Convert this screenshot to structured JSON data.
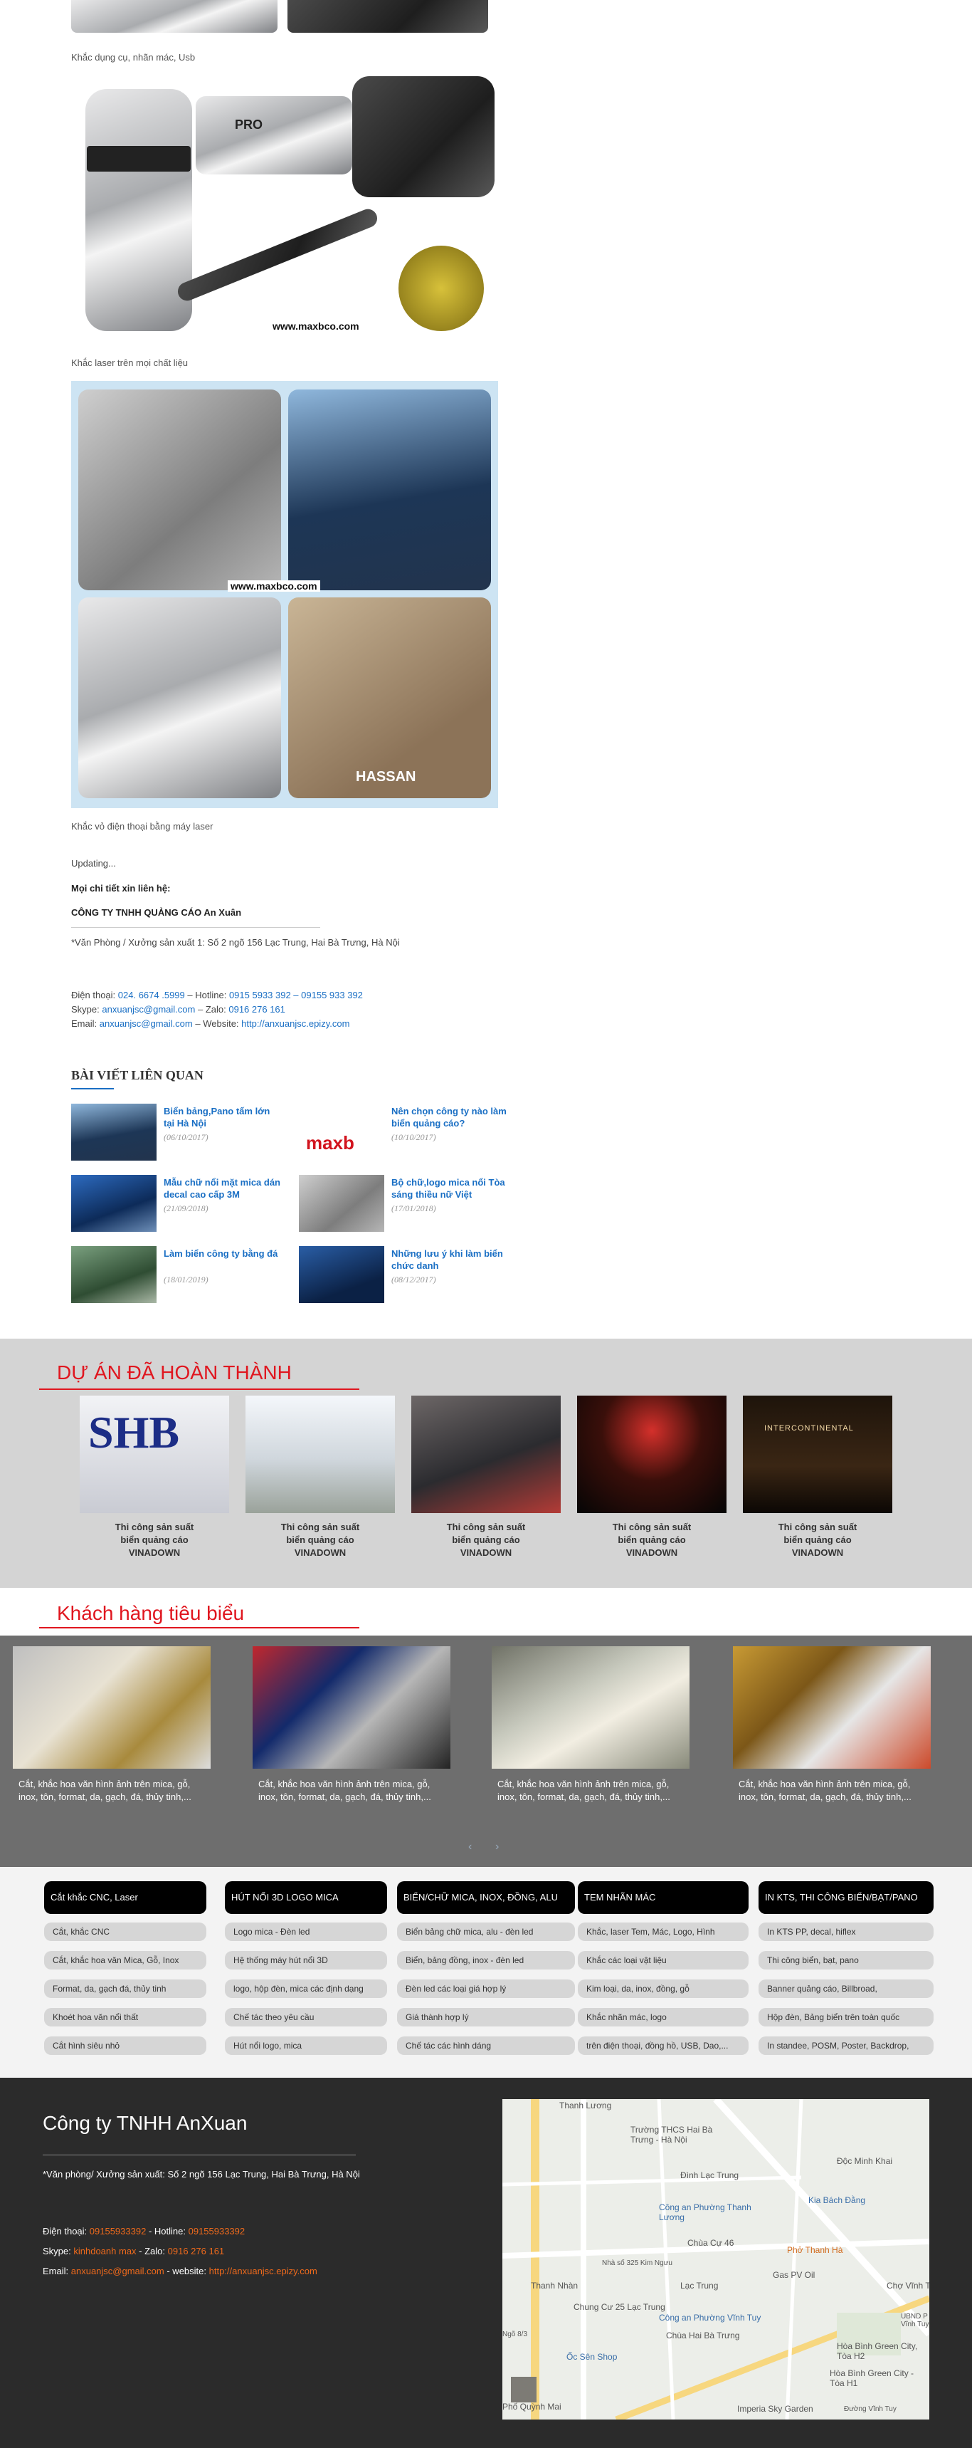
{
  "article": {
    "caption_tools": "Khắc dụng cụ, nhãn mác, Usb",
    "watermark": "www.maxbco.com",
    "caption_laser": "Khắc laser trên mọi chất liệu",
    "caption_phone": "Khắc vỏ điện thoại bằng máy laser",
    "updating": "Updating...",
    "contact_heading": "Mọi chi tiết xin liên hệ:",
    "company": "CÔNG TY TNHH QUẢNG CÁO An Xuân",
    "address": "*Văn Phòng / Xưởng sản xuất 1: Số 2 ngõ 156 Lạc Trung, Hai Bà Trưng, Hà Nội",
    "phone_label": "Điện thoại:",
    "phone": "024. 6674 .5999",
    "hotline_label": "– Hotline:",
    "hotline": "0915 5933 392 – 09155 933 392",
    "skype_label": "Skype:",
    "skype": "anxuanjsc@gmail.com",
    "zalo_label": "– Zalo:",
    "zalo": "0916 276 161",
    "email_label": "Email:",
    "email": "anxuanjsc@gmail.com",
    "website_label": "– Website:",
    "website": "http://anxuanjsc.epizy.com"
  },
  "related": {
    "heading": "BÀI VIẾT LIÊN QUAN",
    "items": [
      {
        "title": "Biển bảng,Pano tấm lớn tại Hà Nội",
        "date": "(06/10/2017)"
      },
      {
        "title": "Nên chọn công ty nào làm biển quảng cáo?",
        "date": "(10/10/2017)",
        "logo": "maxb"
      },
      {
        "title": "Mẫu chữ nổi mặt mica dán decal cao cấp 3M",
        "date": "(21/09/2018)"
      },
      {
        "title": "Bộ chữ,logo mica nổi Tòa sáng thiều nữ Việt",
        "date": "(17/01/2018)"
      },
      {
        "title": "Làm biển công ty bằng đá",
        "date": "(18/01/2019)"
      },
      {
        "title": "Những lưu ý khi làm biển chức danh",
        "date": "(08/12/2017)"
      }
    ]
  },
  "projects": {
    "heading": "DỰ ÁN ĐÃ HOÀN THÀNH",
    "items": [
      {
        "line1": "Thi công sản suất",
        "line2": "biển quảng cáo",
        "line3": "VINADOWN",
        "sign": "SHB"
      },
      {
        "line1": "Thi công sản suất",
        "line2": "biển quảng cáo",
        "line3": "VINADOWN",
        "sign": ""
      },
      {
        "line1": "Thi công sản suất",
        "line2": "biển quảng cáo",
        "line3": "VINADOWN",
        "sign": ""
      },
      {
        "line1": "Thi công sản suất",
        "line2": "biển quảng cáo",
        "line3": "VINADOWN",
        "sign": ""
      },
      {
        "line1": "Thi công sản suất",
        "line2": "biển quảng cáo",
        "line3": "VINADOWN",
        "sign": "INTERCONTINENTAL"
      }
    ]
  },
  "customers": {
    "heading": "Khách hàng tiêu biểu",
    "items": [
      {
        "line1": "Cắt, khắc hoa văn hình ảnh trên mica, gỗ,",
        "line2": "inox, tôn, format, da, gạch, đá, thủy tinh,..."
      },
      {
        "line1": "Cắt, khắc hoa văn hình ảnh trên mica, gỗ,",
        "line2": "inox, tôn, format, da, gạch, đá, thủy tinh,..."
      },
      {
        "line1": "Cắt, khắc hoa văn hình ảnh trên mica, gỗ,",
        "line2": "inox, tôn, format, da, gạch, đá, thủy tinh,..."
      },
      {
        "line1": "Cắt, khắc hoa văn hình ảnh trên mica, gỗ,",
        "line2": "inox, tôn, format, da, gạch, đá, thủy tinh,..."
      }
    ],
    "prev": "‹",
    "next": "›"
  },
  "categories": [
    {
      "title": "Cắt khắc CNC, Laser",
      "items": [
        "Cắt, khắc CNC",
        "Cắt, khắc hoa văn Mica, Gỗ, Inox",
        "Format, da, gạch đá, thủy tinh",
        "Khoét hoa văn nổi thất",
        "Cắt hình siêu nhỏ"
      ]
    },
    {
      "title": "HÚT NỔI 3D LOGO MICA",
      "items": [
        "Logo mica - Đèn led",
        "Hệ thống máy hút nổi 3D",
        "logo, hộp đèn, mica các định dạng",
        "Chế tác theo yêu cầu",
        "Hút nổi logo, mica"
      ]
    },
    {
      "title": "BIỂN/CHỮ MICA, INOX, ĐỒNG, ALU",
      "items": [
        "Biển bảng chữ mica, alu - đèn led",
        "Biển, bảng đồng, inox - đèn led",
        "Đèn led các loại giá hợp lý",
        "Giá thành hợp lý",
        "Chế tác các hình dáng"
      ]
    },
    {
      "title": "TEM NHÃN MÁC",
      "items": [
        "Khắc, laser Tem, Mác, Logo, Hình",
        "Khắc các loại vật liệu",
        "Kim loại, da, inox, đồng, gỗ",
        "Khắc nhãn mác, logo",
        "trên điện thoại, đồng hồ, USB, Dao,..."
      ]
    },
    {
      "title": "IN KTS, THI CÔNG BIỂN/BẠT/PANO",
      "items": [
        "In KTS PP, decal, hiflex",
        "Thi công biển, bạt, pano",
        "Banner quảng cáo, Billbroad,",
        "Hộp đèn, Bảng biển trên toàn quốc",
        "In standee, POSM, Poster, Backdrop,"
      ]
    }
  ],
  "footer": {
    "title": "Công ty TNHH AnXuan",
    "address": "*Văn phòng/ Xưởng sản xuất: Số 2 ngõ 156 Lạc Trung, Hai Bà Trưng, Hà Nội",
    "phone_label": "Điện thoại:",
    "phone": "09155933392",
    "hotline_label": "- Hotline:",
    "hotline": "09155933392",
    "skype_label": "Skype:",
    "skype": "kinhdoanh max",
    "zalo_label": "- Zalo:",
    "zalo": "0916 276 161",
    "email_label": "Email:",
    "email": "anxuanjsc@gmail.com",
    "website_label": "- website:",
    "website": "http://anxuanjsc.epizy.com"
  },
  "map": {
    "labels": [
      "Thanh Lương",
      "Trường THCS Hai Bà Trưng - Hà Nội",
      "Độc Minh Khai",
      "Đình Lạc Trung",
      "Công an Phường Thanh Lương",
      "Kia Bách Đằng",
      "Chùa Cự 46",
      "Nhà số 325 Kim Ngưu",
      "Phở Thanh Hà",
      "Gas PV Oil",
      "Thanh Nhàn",
      "Lạc Trung",
      "Chung Cư 25 Lạc Trung",
      "Công an Phường Vĩnh Tuy",
      "Chợ Vĩnh Tuy",
      "Chùa Hai Bà Trưng",
      "Ốc Sên Shop",
      "Hòa Bình Green City, Tòa H2",
      "Hòa Bình Green City - Tòa H1",
      "Phố Quỳnh Mai",
      "Imperia Sky Garden",
      "UBND P Vĩnh Tuy",
      "Ngõ 8/3",
      "Đường Vĩnh Tuy"
    ]
  },
  "colors": {
    "accent_red": "#e0161f",
    "link_blue": "#1a6fc4",
    "footer_bg": "#2b2b2b",
    "highlight_orange": "#ef6a1c"
  }
}
